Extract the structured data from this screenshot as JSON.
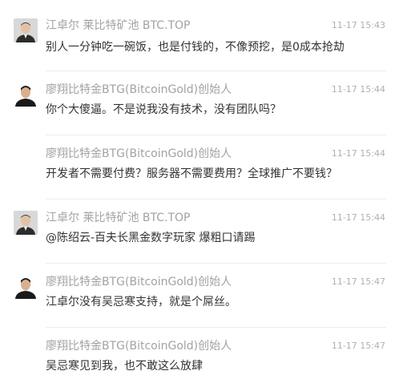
{
  "comments": [
    {
      "author": "江卓尔 莱比特矿池 BTC.TOP",
      "time": "11-17 15:43",
      "text": "别人一分钟吃一碗饭，也是付钱的，不像预挖，是0成本抢劫",
      "avatar": "avatar-gray-icon"
    },
    {
      "author": "廖翔比特金BTG(BitcoinGold)创始人",
      "time": "11-17 15:44",
      "text": "你个大傻逼。不是说我没有技术，没有团队吗？",
      "avatar": "avatar-white-icon"
    },
    {
      "author": "廖翔比特金BTG(BitcoinGold)创始人",
      "time": "11-17 15:44",
      "text": "开发者不需要付费？服务器不需要费用？全球推广不要钱？"
    },
    {
      "author": "江卓尔 莱比特矿池 BTC.TOP",
      "time": "11-17 15:44",
      "text": "@陈绍云-百夫长黑金数字玩家 爆粗口请踢",
      "avatar": "avatar-gray-icon"
    },
    {
      "author": "廖翔比特金BTG(BitcoinGold)创始人",
      "time": "11-17 15:47",
      "text": "江卓尔没有吴忌寒支持，就是个屌丝。",
      "avatar": "avatar-white-icon"
    },
    {
      "author": "廖翔比特金BTG(BitcoinGold)创始人",
      "time": "11-17 15:47",
      "text": "吴忌寒见到我，也不敢这么放肆"
    }
  ]
}
